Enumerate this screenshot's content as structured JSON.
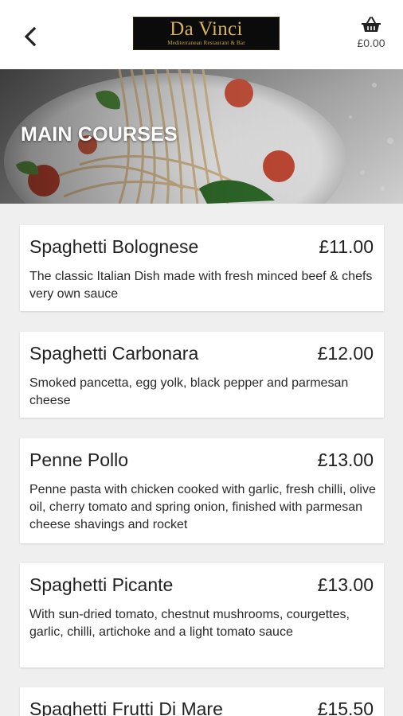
{
  "header": {
    "back_icon": "chevron-left-icon",
    "logo_name": "Da Vinci",
    "logo_tagline": "Mediterranean Restaurant & Bar",
    "cart_icon": "basket-icon",
    "cart_total": "£0.00"
  },
  "hero": {
    "title": "MAIN COURSES"
  },
  "menu_items": [
    {
      "name": "Spaghetti Bolognese",
      "price": "£11.00",
      "description": "The classic Italian Dish made with fresh minced beef & chefs very own sauce"
    },
    {
      "name": "Spaghetti Carbonara",
      "price": "£12.00",
      "description": "Smoked pancetta, egg yolk, black pepper and parmesan cheese"
    },
    {
      "name": "Penne Pollo",
      "price": "£13.00",
      "description": "Penne pasta with chicken cooked with garlic, fresh chilli, olive oil, cherry tomato and spring onion, finished with parmesan cheese shavings and rocket"
    },
    {
      "name": "Spaghetti Picante",
      "price": "£13.00",
      "description": "With sun-dried tomato, chestnut mushrooms, courgettes, garlic, chilli, artichoke and a light tomato sauce"
    },
    {
      "name": "Spaghetti Frutti Di Mare",
      "price": "£15.50",
      "description": ""
    }
  ],
  "colors": {
    "background": "#efefef",
    "card": "#ffffff",
    "logo_background": "#0b0b0b",
    "logo_gold": "#d8b35a"
  }
}
